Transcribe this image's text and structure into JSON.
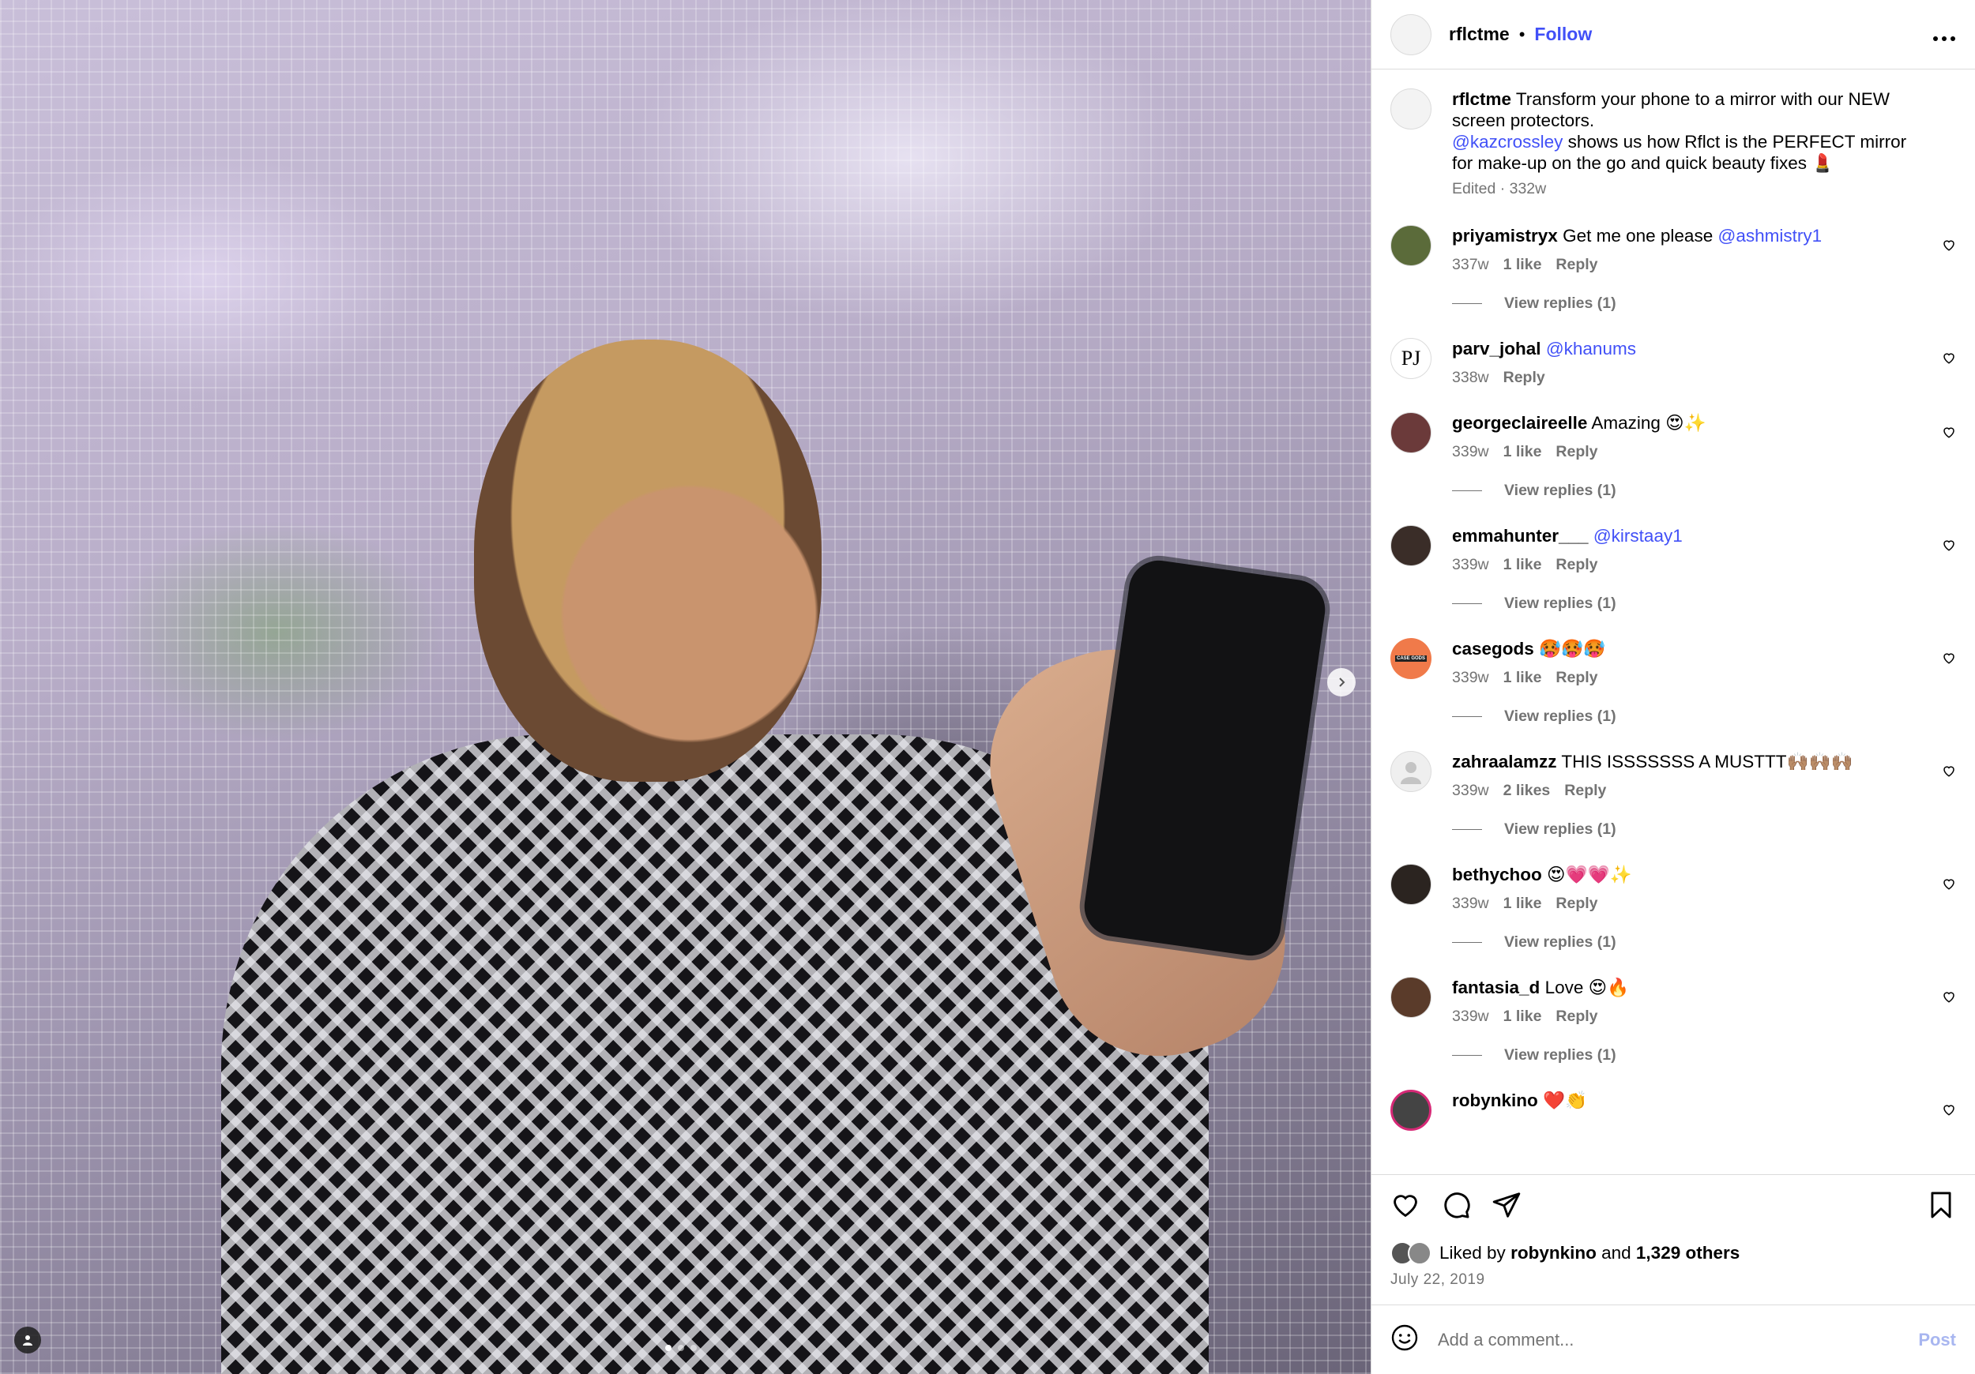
{
  "post": {
    "username": "rflctme",
    "separator": "•",
    "follow_label": "Follow",
    "more_label": "•••"
  },
  "caption": {
    "username": "rflctme",
    "text_1": "Transform your phone to a mirror with our NEW screen protectors.",
    "mention": "@kazcrossley",
    "text_2": "shows us how Rflct is the PERFECT mirror for make-up on the go and quick beauty fixes 💄",
    "meta": "Edited · 332w"
  },
  "reply_label": "Reply",
  "comments": [
    {
      "username": "priyamistryx",
      "text": "Get me one please",
      "mention": "@ashmistry1",
      "age": "337w",
      "likes": "1 like",
      "view_replies": "View replies (1)",
      "avatar_color": "#5b6b3a"
    },
    {
      "username": "parv_johal",
      "text": "",
      "mention": "@khanums",
      "age": "338w",
      "likes": "",
      "view_replies": "",
      "avatar_text": "PJ",
      "avatar_color": "#ffffff"
    },
    {
      "username": "georgeclaireelle",
      "text": "Amazing 😍✨",
      "mention": "",
      "age": "339w",
      "likes": "1 like",
      "view_replies": "View replies (1)",
      "avatar_color": "#6b3a3a"
    },
    {
      "username": "emmahunter___",
      "text": "",
      "mention": "@kirstaay1",
      "age": "339w",
      "likes": "1 like",
      "view_replies": "View replies (1)",
      "avatar_color": "#3a2d28"
    },
    {
      "username": "casegods",
      "text": "🥵🥵🥵",
      "mention": "",
      "age": "339w",
      "likes": "1 like",
      "view_replies": "View replies (1)",
      "avatar_text": "CASE GODS",
      "avatar_color": "#f07a4a"
    },
    {
      "username": "zahraalamzz",
      "text": "THIS ISSSSSSS A MUSTTT🙌🏽🙌🏽🙌🏽",
      "mention": "",
      "age": "339w",
      "likes": "2 likes",
      "view_replies": "View replies (1)",
      "avatar_color": "#dbdbdb"
    },
    {
      "username": "bethychoo",
      "text": "😍💗💗✨",
      "mention": "",
      "age": "339w",
      "likes": "1 like",
      "view_replies": "View replies (1)",
      "avatar_color": "#2b2420"
    },
    {
      "username": "fantasia_d",
      "text": "Love 😍🔥",
      "mention": "",
      "age": "339w",
      "likes": "1 like",
      "view_replies": "View replies (1)",
      "avatar_color": "#5a3b2a"
    },
    {
      "username": "robynkino",
      "text": "❤️👏",
      "mention": "",
      "age": "",
      "likes": "",
      "view_replies": "",
      "avatar_color": "#444444"
    }
  ],
  "likes": {
    "prefix": "Liked by",
    "user": "robynkino",
    "middle": "and",
    "count": "1,329 others"
  },
  "date": "July 22, 2019",
  "add_comment": {
    "placeholder": "Add a comment...",
    "post_label": "Post"
  },
  "colors": {
    "link": "#4150f7",
    "muted": "#737373",
    "border": "#dbdbdb"
  },
  "icons": [
    "heart-icon",
    "comment-icon",
    "share-icon",
    "bookmark-icon",
    "emoji-icon",
    "chevron-right-icon",
    "user-tag-icon",
    "more-icon"
  ]
}
